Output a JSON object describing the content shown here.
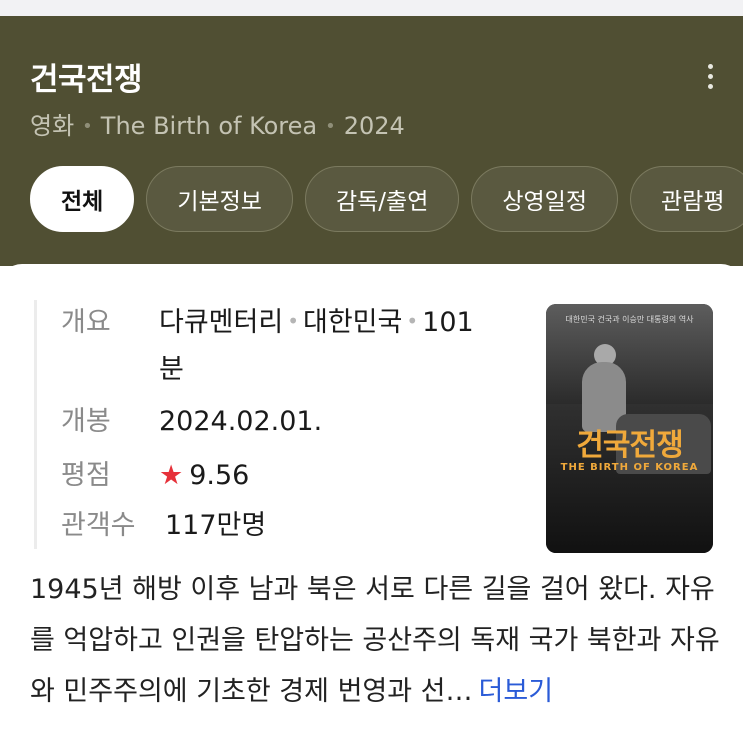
{
  "header": {
    "title": "건국전쟁",
    "category": "영화",
    "english_title": "The Birth of Korea",
    "year": "2024"
  },
  "tabs": [
    {
      "label": "전체",
      "active": true
    },
    {
      "label": "기본정보",
      "active": false
    },
    {
      "label": "감독/출연",
      "active": false
    },
    {
      "label": "상영일정",
      "active": false
    },
    {
      "label": "관람평",
      "active": false
    }
  ],
  "info": {
    "overview_label": "개요",
    "genre": "다큐멘터리",
    "country": "대한민국",
    "runtime_part1": "101",
    "runtime_part2": "분",
    "release_label": "개봉",
    "release_date": "2024.02.01.",
    "rating_label": "평점",
    "rating_value": "9.56",
    "audience_label": "관객수",
    "audience_value": "117만명"
  },
  "poster": {
    "tagline": "대한민국 건국과 이승만 대통령의 역사",
    "title": "건국전쟁",
    "subtitle": "THE BIRTH OF KOREA"
  },
  "description": {
    "text": "1945년 해방 이후 남과 북은 서로 다른 길을 걸어 왔다. 자유를 억압하고 인권을 탄압하는 공산주의 독재 국가 북한과 자유와 민주주의에 기초한 경제 번영과 선…",
    "more_label": "더보기"
  },
  "colors": {
    "header_bg": "#504f33",
    "accent_link": "#2a5bd7",
    "star": "#e6313a"
  }
}
